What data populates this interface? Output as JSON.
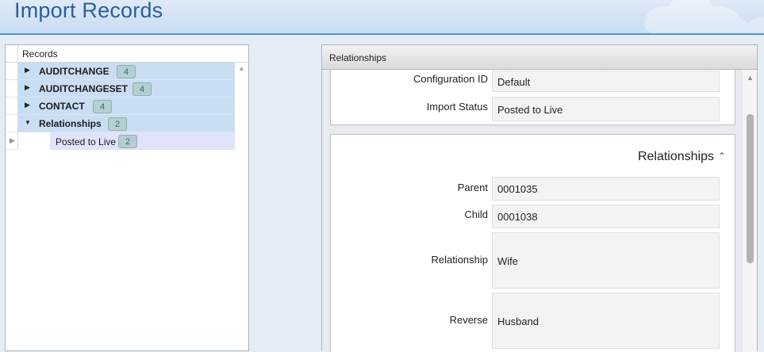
{
  "header": {
    "title": "Import Records"
  },
  "records_grid": {
    "column_header": "Records",
    "rows": [
      {
        "label": "AUDITCHANGE",
        "count": "4"
      },
      {
        "label": "AUDITCHANGESET",
        "count": "4"
      },
      {
        "label": "CONTACT",
        "count": "4"
      },
      {
        "label": "Relationships",
        "count": "2"
      }
    ],
    "child": {
      "label": "Posted to Live",
      "count": "2"
    }
  },
  "detail": {
    "panel_title": "Relationships",
    "summary": {
      "configuration_id": {
        "label": "Configuration ID",
        "value": "Default"
      },
      "import_status": {
        "label": "Import Status",
        "value": "Posted to Live"
      }
    },
    "section": {
      "title": "Relationships",
      "fields": {
        "parent": {
          "label": "Parent",
          "value": "0001035"
        },
        "child": {
          "label": "Child",
          "value": "0001038"
        },
        "relationship": {
          "label": "Relationship",
          "value": "Wife"
        },
        "reverse": {
          "label": "Reverse",
          "value": "Husband"
        }
      }
    }
  }
}
